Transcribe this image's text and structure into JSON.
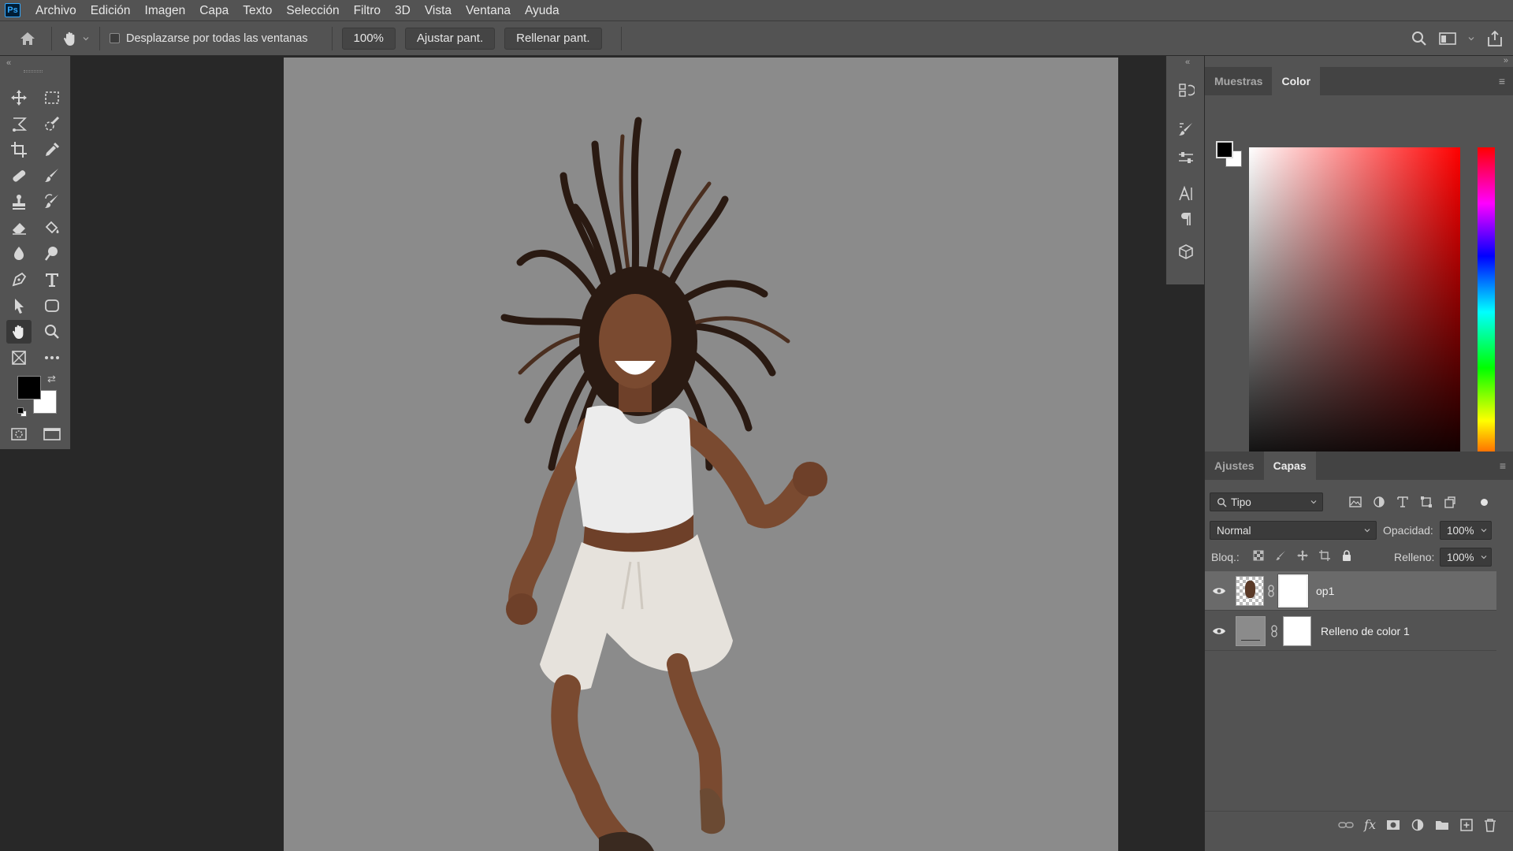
{
  "app": {
    "logo": "Ps"
  },
  "menu": [
    "Archivo",
    "Edición",
    "Imagen",
    "Capa",
    "Texto",
    "Selección",
    "Filtro",
    "3D",
    "Vista",
    "Ventana",
    "Ayuda"
  ],
  "options": {
    "scroll_all_label": "Desplazarse por todas las ventanas",
    "zoom_value": "100%",
    "fit_screen": "Ajustar pant.",
    "fill_screen": "Rellenar pant."
  },
  "colors": {
    "foreground": "#000000",
    "background": "#ffffff",
    "canvas_bg": "#8b8b8b"
  },
  "color_panel": {
    "tabs": [
      "Muestras",
      "Color"
    ],
    "active_tab": "Color"
  },
  "layers_panel": {
    "tabs": [
      "Ajustes",
      "Capas"
    ],
    "active_tab": "Capas",
    "filter_kind": "Tipo",
    "blend_mode": "Normal",
    "opacity_label": "Opacidad:",
    "opacity_value": "100%",
    "lock_label": "Bloq.:",
    "fill_label": "Relleno:",
    "fill_value": "100%",
    "layers": [
      {
        "name": "op1",
        "selected": true
      },
      {
        "name": "Relleno de color 1",
        "selected": false
      }
    ]
  }
}
